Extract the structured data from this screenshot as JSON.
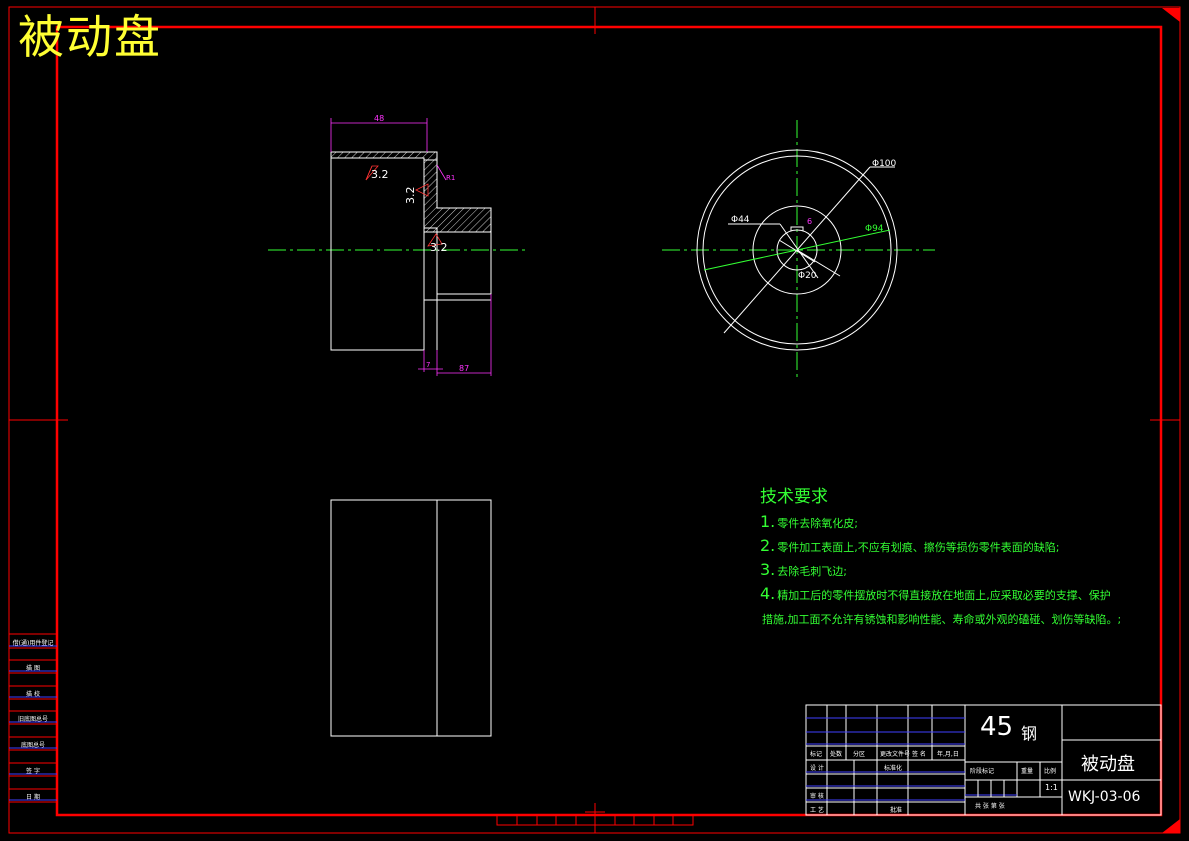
{
  "title": "被动盘",
  "dimensions": {
    "length_top": "48",
    "step": "7",
    "length_bottom": "87",
    "chamfer": "R1",
    "diameter_outer": "Φ100",
    "diameter_inner_ring": "Φ44",
    "diameter_mid": "Φ94",
    "diameter_bore": "Φ20",
    "keyway": "6"
  },
  "roughness": [
    "3.2",
    "3.2",
    "3.2"
  ],
  "tech_requirements": {
    "title": "技术要求",
    "items": [
      {
        "num": "1.",
        "text": "零件去除氧化皮;"
      },
      {
        "num": "2.",
        "text": "零件加工表面上,不应有划痕、擦伤等损伤零件表面的缺陷;"
      },
      {
        "num": "3.",
        "text": "去除毛刺飞边;"
      },
      {
        "num": "4.",
        "text": "精加工后的零件摆放时不得直接放在地面上,应采取必要的支撑、保护"
      },
      {
        "num": "",
        "text": "措施,加工面不允许有锈蚀和影响性能、寿命或外观的磕碰、划伤等缺陷。;"
      }
    ]
  },
  "title_block": {
    "material_num": "45",
    "material_unit": "钢",
    "part_name": "被动盘",
    "drawing_number": "WKJ-03-06",
    "scale": "1:1",
    "row_labels": [
      "标记",
      "处数",
      "分区",
      "更改文件号",
      "签 名",
      "年,月,日"
    ],
    "design": "设 计",
    "standardize": "标准化",
    "stage_mark": "阶段标记",
    "weight": "重量",
    "ratio": "比例",
    "review": "审 核",
    "process": "工 艺",
    "approve": "批准",
    "sheets": "共  张  第  张"
  },
  "side_labels": [
    "借(通)用件登记",
    "描 图",
    "描 校",
    "旧底图总号",
    "底图总号",
    "签 字",
    "日 期"
  ],
  "colors": {
    "border": "#ff0000",
    "title": "#ffff33",
    "tech": "#33ff33",
    "dim": "#ff33ff",
    "center": "#33ff33",
    "line": "#ffffff"
  }
}
